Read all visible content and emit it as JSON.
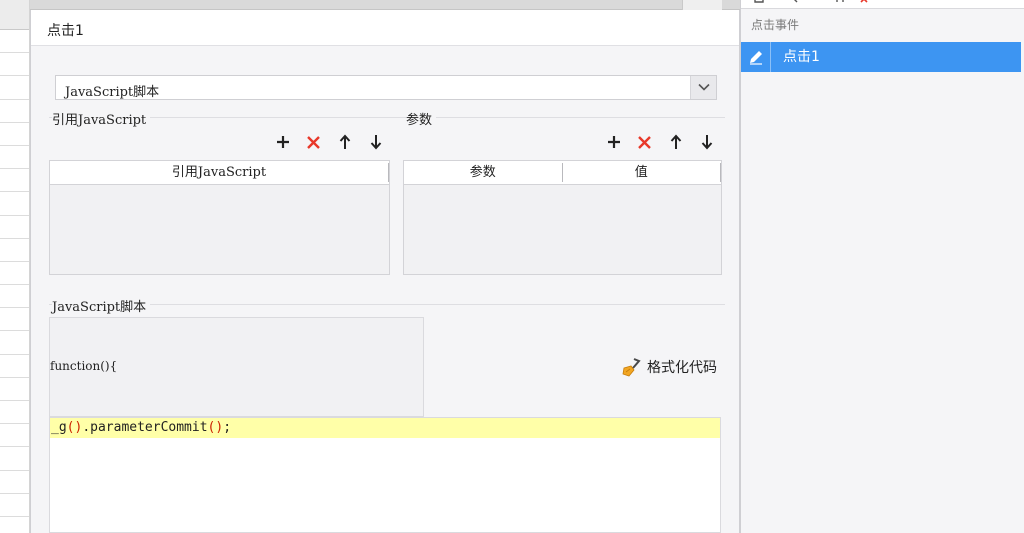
{
  "dialog": {
    "title": "点击1",
    "type_select": {
      "value": "JavaScript脚本"
    },
    "ref_section": {
      "label": "引用JavaScript",
      "columns": [
        "引用JavaScript"
      ]
    },
    "param_section": {
      "label": "参数",
      "columns": [
        "参数",
        "值"
      ]
    },
    "script_section": {
      "label": "JavaScript脚本",
      "function_header": "function(){",
      "format_button": "格式化代码",
      "code_prefix": "_g",
      "code_call": ".parameterCommit",
      "code_end": ";"
    },
    "toolbar_icons": [
      "plus-icon",
      "delete-icon",
      "arrow-up-icon",
      "arrow-down-icon"
    ],
    "colors": {
      "delete": "#e8382a",
      "highlight": "#ffffa8",
      "paren": "#cc2200"
    }
  },
  "right_panel": {
    "label": "点击事件",
    "items": [
      {
        "label": "点击1",
        "selected": true,
        "icon": "edit-icon"
      }
    ],
    "colors": {
      "selected": "#3d95f2"
    }
  }
}
